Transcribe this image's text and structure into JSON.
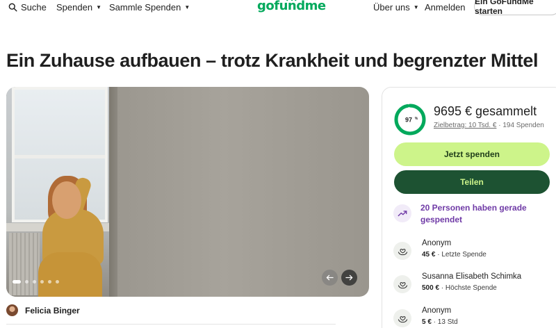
{
  "header": {
    "search_label": "Suche",
    "donate_menu_label": "Spenden",
    "collect_menu_label": "Sammle Spenden",
    "logo_text": "gofundme",
    "about_menu_label": "Über uns",
    "login_label": "Anmelden",
    "start_button_label": "Ein GoFundMe starten"
  },
  "campaign": {
    "title": "Ein Zuhause aufbauen – trotz Krankheit und begrenzter Mittel",
    "organizer_name": "Felicia Binger",
    "carousel": {
      "slide_count": 6,
      "active_index": 0
    }
  },
  "donation": {
    "percent_label": "97",
    "percent_sign": "%",
    "progress_fraction": 0.97,
    "raised_text": "9695 € gesammelt",
    "goal_text": "Zielbetrag: 10 Tsd. €",
    "separator": "·",
    "donation_count_text": "194 Spenden",
    "donate_button_label": "Jetzt spenden",
    "share_button_label": "Teilen",
    "recent_activity_text": "20 Personen haben gerade gespendet",
    "donors": [
      {
        "name": "Anonym",
        "amount": "45 €",
        "note": "Letzte Spende"
      },
      {
        "name": "Susanna Elisabeth Schimka",
        "amount": "500 €",
        "note": "Höchste Spende"
      },
      {
        "name": "Anonym",
        "amount": "5 €",
        "note": "13 Std"
      }
    ]
  },
  "colors": {
    "brand_green": "#02a95c",
    "donate_button_bg": "#cdf48a",
    "share_button_bg": "#1d5232",
    "activity_purple": "#6f3aa6"
  },
  "icons": {
    "search": "search-icon",
    "trend": "trending-up-icon",
    "donor": "heart-hands-icon",
    "prev": "arrow-left-icon",
    "next": "arrow-right-icon"
  }
}
